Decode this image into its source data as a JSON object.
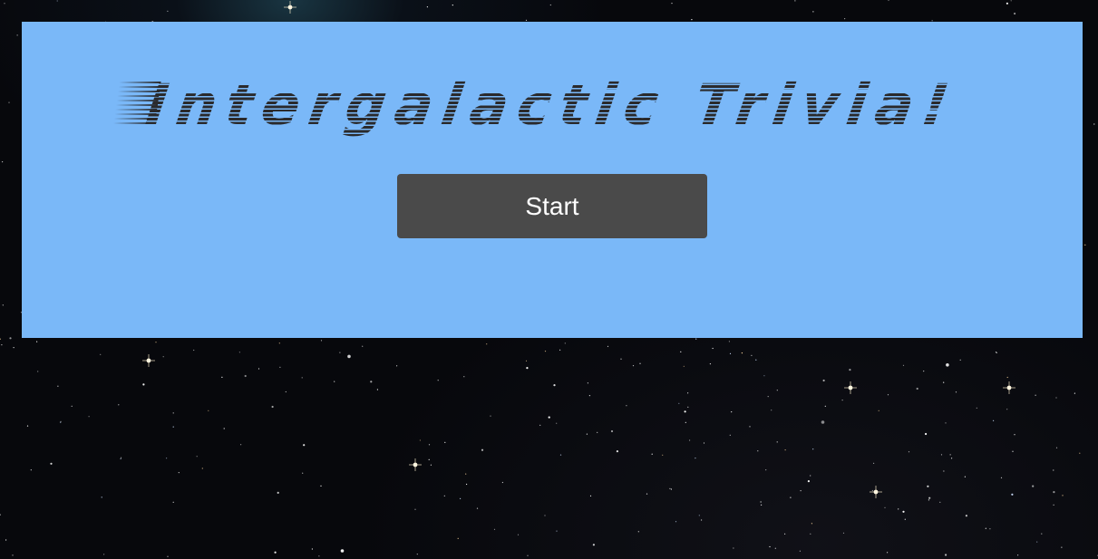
{
  "app": {
    "title": "Intergalactic Trivia!"
  },
  "controls": {
    "start_label": "Start"
  },
  "colors": {
    "panel_background": "#7ab8f8",
    "title_text": "#2a2a2c",
    "button_background": "#4a4a4a",
    "button_text": "#ffffff",
    "page_background": "#07080c"
  },
  "background": {
    "type": "starfield"
  }
}
